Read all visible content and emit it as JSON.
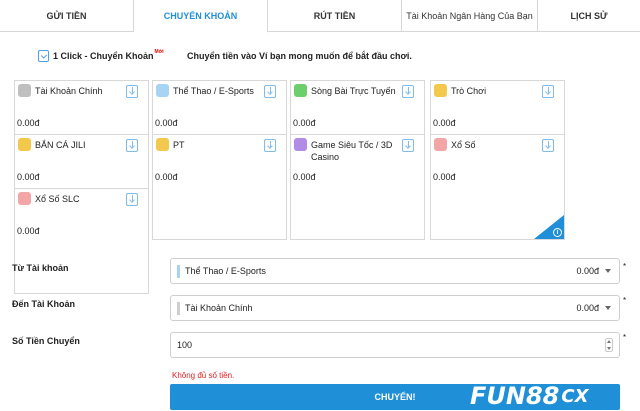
{
  "tabs": [
    {
      "label": "GỬI TIỀN"
    },
    {
      "label": "CHUYỂN KHOẢN"
    },
    {
      "label": "RÚT TIỀN"
    },
    {
      "label": "Tài Khoản Ngân Hàng Của Bạn"
    },
    {
      "label": "LỊCH SỬ"
    }
  ],
  "active_tab": "CHUYỂN KHOẢN",
  "oneclick": {
    "label": "1 Click - Chuyển Khoản",
    "badge": "Mới"
  },
  "instruction": "Chuyển tiền vào Ví bạn mong muốn để bắt đầu chơi.",
  "wallets": [
    {
      "name": "Tài Khoản Chính",
      "balance": "0.00đ",
      "icon": "wallet-icon",
      "color": "#bfbfbf"
    },
    {
      "name": "Thể Thao / E-Sports",
      "balance": "0.00đ",
      "icon": "sports-icon",
      "color": "#a8d4f3"
    },
    {
      "name": "Sòng Bài Trực Tuyến",
      "balance": "0.00đ",
      "icon": "casino-icon",
      "color": "#6ccf6c"
    },
    {
      "name": "Trò Chơi",
      "balance": "0.00đ",
      "icon": "games-icon",
      "color": "#f2c94c"
    },
    {
      "name": "BẮN CÁ JILI",
      "balance": "0.00đ",
      "icon": "fishing-icon",
      "color": "#f2c94c"
    },
    {
      "name": "PT",
      "balance": "0.00đ",
      "icon": "pt-icon",
      "color": "#f2c94c"
    },
    {
      "name": "Game Siêu Tốc / 3D Casino",
      "balance": "0.00đ",
      "icon": "fast-game-icon",
      "color": "#b18ce6"
    },
    {
      "name": "Xổ Số",
      "balance": "0.00đ",
      "icon": "lottery-icon",
      "color": "#f4a6a6"
    },
    {
      "name": "Xổ Số SLC",
      "balance": "0.00đ",
      "icon": "lottery-slc-icon",
      "color": "#f4a6a6"
    }
  ],
  "info_symbol": "i",
  "form": {
    "from_label": "Từ Tài khoản",
    "from_value": "Thể Thao / E-Sports",
    "from_amount": "0.00đ",
    "to_label": "Đến Tài Khoản",
    "to_value": "Tài Khoản Chính",
    "to_amount": "0.00đ",
    "amount_label": "Số Tiền Chuyển",
    "amount_value": "100",
    "required_mark": "*",
    "error": "Không đủ số tiền.",
    "submit_label": "CHUYỂN!"
  },
  "brand": {
    "main": "FUN88",
    "suffix": "CX"
  },
  "colors": {
    "accent": "#1f8fd8",
    "error": "#e02020"
  }
}
